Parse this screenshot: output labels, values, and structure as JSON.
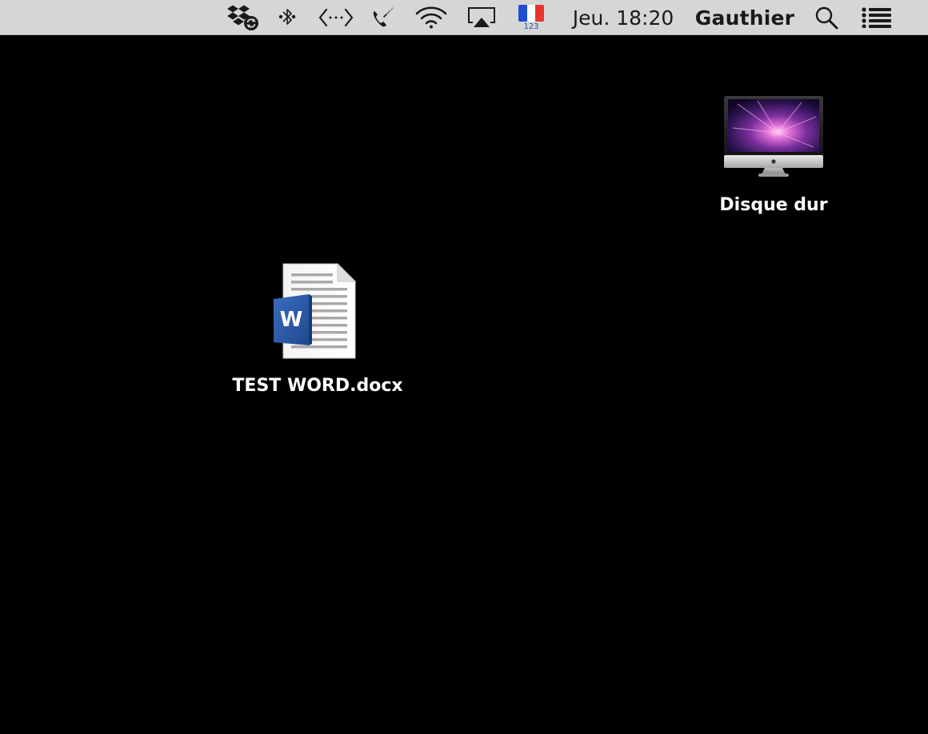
{
  "menubar": {
    "icons": {
      "dropbox": "dropbox-sync-icon",
      "bluetooth": "bluetooth-icon",
      "code": "code-brackets-icon",
      "phone": "phone-icon",
      "wifi": "wifi-icon",
      "airplay": "airplay-icon",
      "input_source": "french-flag-icon",
      "spotlight": "search-icon",
      "notification_center": "list-icon"
    },
    "input_source_label": "123",
    "clock": "Jeu. 18:20",
    "user": "Gauthier",
    "flag_colors": [
      "#1f4fd1",
      "#ffffff",
      "#e8352b"
    ]
  },
  "desktop": {
    "background": "#000000",
    "hard_disk": {
      "label": "Disque dur",
      "icon": "imac-icon"
    },
    "document": {
      "label": "TEST WORD.docx",
      "icon": "word-document-icon",
      "badge": "W",
      "accent": "#2b579a"
    }
  }
}
